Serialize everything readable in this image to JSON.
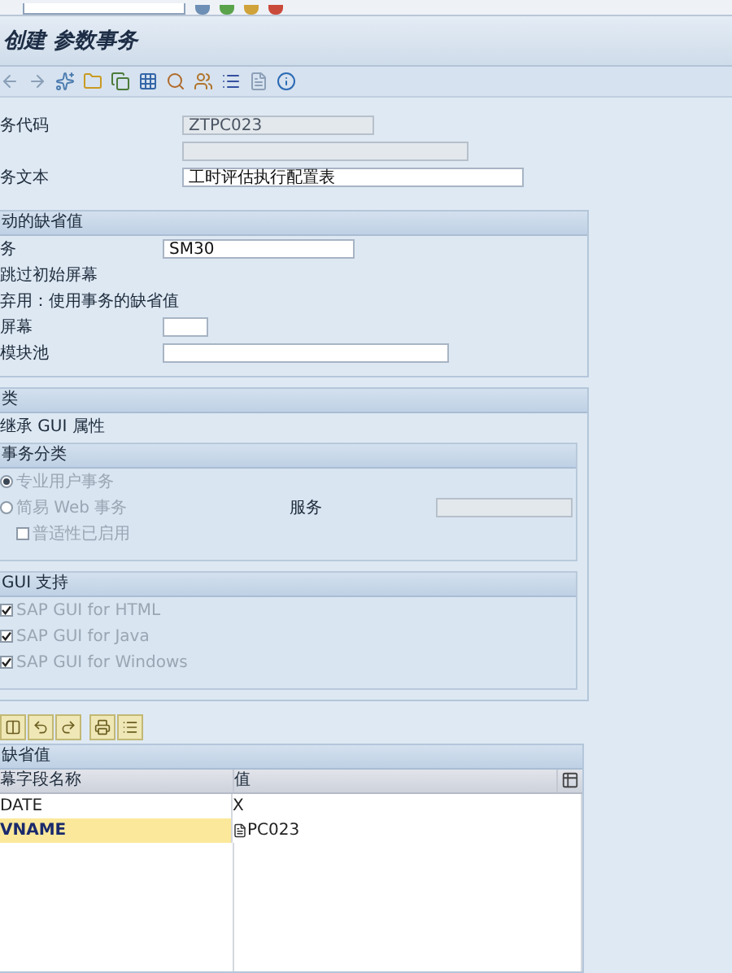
{
  "title": "创建 参数事务",
  "header_fields": [
    {
      "label": "务代码",
      "value": "ZTPC023",
      "disabled": true
    },
    {
      "disabled": true
    },
    {
      "label": "务文本",
      "value": "工时评估执行配置表",
      "disabled": false
    }
  ],
  "default_values": {
    "title": "动的缺省值",
    "rows": [
      {
        "kind": "field",
        "label": "务",
        "value": "SM30"
      },
      {
        "kind": "text",
        "label": "跳过初始屏幕"
      },
      {
        "kind": "text",
        "label": "弃用：使用事务的缺省值"
      },
      {
        "kind": "field",
        "label": "屏幕"
      },
      {
        "kind": "field",
        "label": "模块池"
      }
    ]
  },
  "classification": {
    "title": "类",
    "inherit_label": "继承 GUI 属性",
    "transaction_class": {
      "title": "事务分类",
      "options": [
        {
          "label": "专业用户事务",
          "selected": true
        },
        {
          "label": "简易 Web 事务",
          "selected": false
        }
      ],
      "service_label": "服务",
      "pervasive": {
        "label": "普适性已启用",
        "checked": false
      }
    },
    "gui_support": {
      "title": "GUI 支持",
      "options": [
        {
          "label": "SAP GUI for HTML",
          "checked": true
        },
        {
          "label": "SAP GUI for Java",
          "checked": true
        },
        {
          "label": "SAP GUI for Windows",
          "checked": true
        }
      ]
    }
  },
  "table": {
    "title": "缺省值",
    "columns": [
      "幕字段名称",
      "值"
    ],
    "rows": [
      {
        "cells": [
          "DATE",
          "X"
        ],
        "selected": false
      },
      {
        "cells": [
          "VNAME",
          "PC023"
        ],
        "selected": true
      }
    ]
  }
}
